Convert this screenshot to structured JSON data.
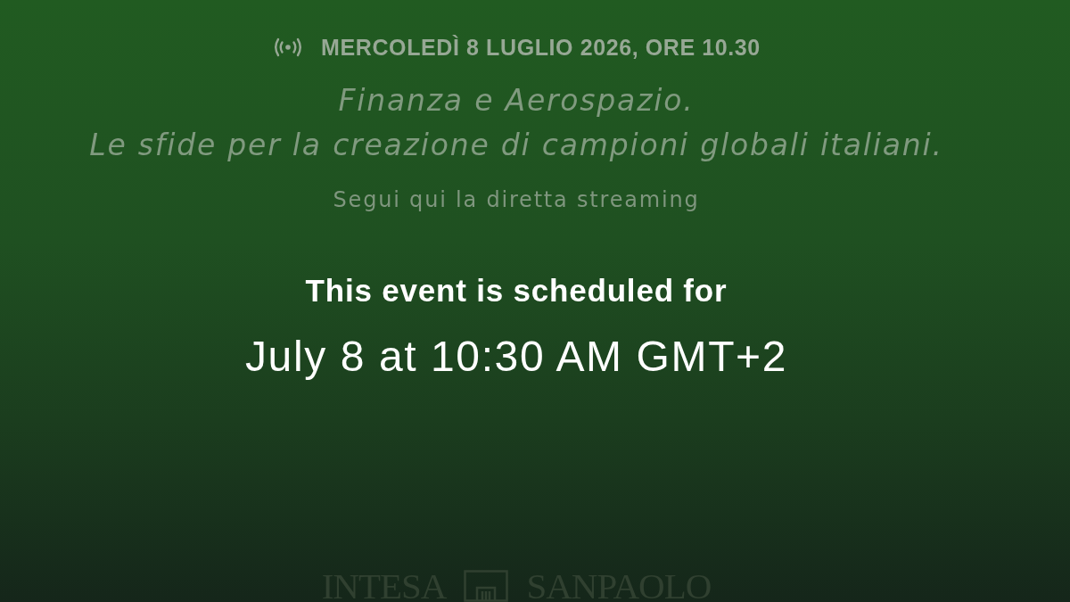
{
  "event_header": {
    "date_time": "MERCOLEDÌ 8 LUGLIO 2026, ORE 10.30"
  },
  "title_lines": [
    "Finanza e Aerospazio.",
    "Le sfide per la creazione di campioni globali italiani."
  ],
  "subtitle": "Segui qui la diretta streaming",
  "schedule_notice": {
    "heading": "This event is scheduled for",
    "time": "July 8 at 10:30 AM GMT+2"
  },
  "footer_logo": {
    "words": [
      "INTESA",
      "SANPAOLO"
    ]
  }
}
